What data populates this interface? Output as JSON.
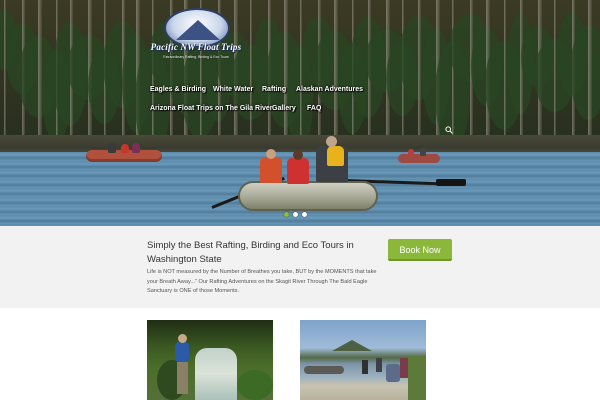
{
  "brand": {
    "name": "Pacific NW Float Trips",
    "tagline": "Extraordinary Rafting, Birding & Eco Tours"
  },
  "nav": {
    "row1": [
      "Eagles & Birding",
      "White Water",
      "Rafting",
      "Alaskan Adventures"
    ],
    "row2": [
      "Arizona Float Trips on The Gila River",
      "Gallery",
      "FAQ"
    ]
  },
  "slider": {
    "slide_count": 3,
    "active_index": 0
  },
  "cta": {
    "title": "Simply the Best Rafting, Birding and Eco Tours in Washington State",
    "text": "Life is NOT measured by the Number of Breathes you take, BUT by the MOMENTS that take your Breath Away...\" Our Rafting Adventures on the Skagit River Through The Bald Eagle Sanctuary is ONE of those Moments.",
    "button_label": "Book Now"
  },
  "colors": {
    "accent": "#8bb83a",
    "cta_background": "#f2f2f2",
    "nav_text": "#ffffff"
  },
  "icons": {
    "search": "search-icon"
  }
}
